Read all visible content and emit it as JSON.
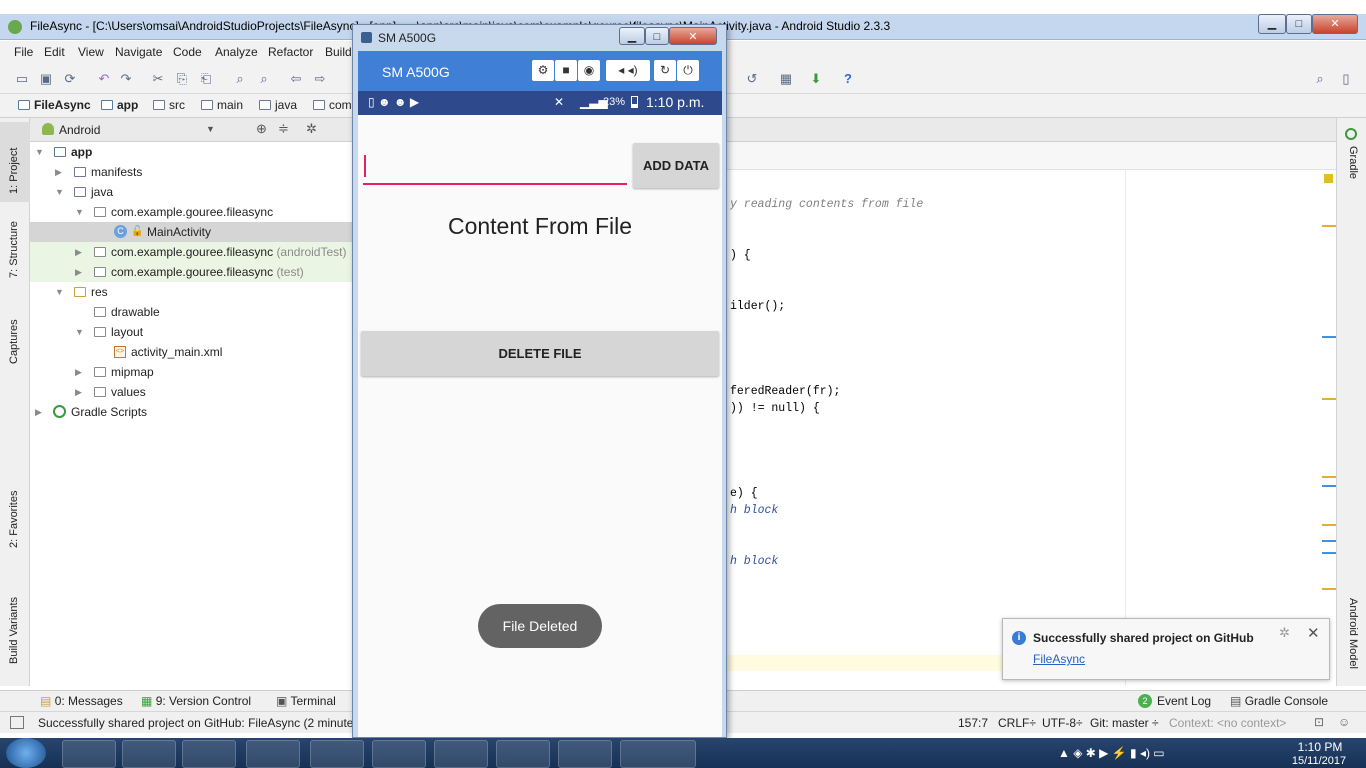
{
  "window": {
    "title": "FileAsync - [C:\\Users\\omsai\\AndroidStudioProjects\\FileAsync] - [app] - ...\\app\\src\\main\\java\\com\\example\\gouree\\fileasync\\MainActivity.java - Android Studio 2.3.3"
  },
  "menu": [
    "File",
    "Edit",
    "View",
    "Navigate",
    "Code",
    "Analyze",
    "Refactor",
    "Build"
  ],
  "breadcrumb": [
    "FileAsync",
    "app",
    "src",
    "main",
    "java",
    "com"
  ],
  "project_panel": {
    "view": "Android"
  },
  "tree": [
    {
      "label": "app"
    },
    {
      "label": "manifests"
    },
    {
      "label": "java"
    },
    {
      "label": "com.example.gouree.fileasync"
    },
    {
      "label": "MainActivity"
    },
    {
      "label": "com.example.gouree.fileasync",
      "suffix": "(androidTest)"
    },
    {
      "label": "com.example.gouree.fileasync",
      "suffix": "(test)"
    },
    {
      "label": "res"
    },
    {
      "label": "drawable"
    },
    {
      "label": "layout"
    },
    {
      "label": "activity_main.xml"
    },
    {
      "label": "mipmap"
    },
    {
      "label": "values"
    },
    {
      "label": "Gradle Scripts"
    }
  ],
  "left_tabs": [
    "1: Project",
    "7: Structure",
    "Captures",
    "2: Favorites",
    "Build Variants"
  ],
  "right_tabs": [
    "Gradle",
    "Android Model"
  ],
  "code_lines": [
    "y reading contents from file",
    ") {",
    "ilder();",
    "feredReader(fr);",
    ")) != null) {",
    "e) {",
    "h block",
    "h block"
  ],
  "bottom_tabs": {
    "messages": "0: Messages",
    "version_control": "9: Version Control",
    "terminal": "Terminal",
    "event_log": "Event Log",
    "event_count": "2",
    "gradle_console": "Gradle Console"
  },
  "status": {
    "message": "Successfully shared project on GitHub: FileAsync (2 minute",
    "position": "157:7",
    "line_sep": "CRLF÷",
    "encoding": "UTF-8÷",
    "git": "Git: master ÷",
    "context": "Context: <no context>"
  },
  "notification": {
    "title": "Successfully shared project on GitHub",
    "link": "FileAsync"
  },
  "emulator": {
    "window_title": "SM A500G",
    "device_label": "SM A500G",
    "status_battery": "23%",
    "status_time": "1:10 p.m.",
    "add_button": "ADD DATA",
    "content_label": "Content From File",
    "delete_button": "DELETE FILE",
    "toast": "File Deleted"
  },
  "taskbar": {
    "time": "1:10 PM",
    "date": "15/11/2017"
  },
  "colors": {
    "accent": "#e91e63",
    "toolbar_blue": "#3f7fd6",
    "status_blue": "#2e4a8c"
  }
}
